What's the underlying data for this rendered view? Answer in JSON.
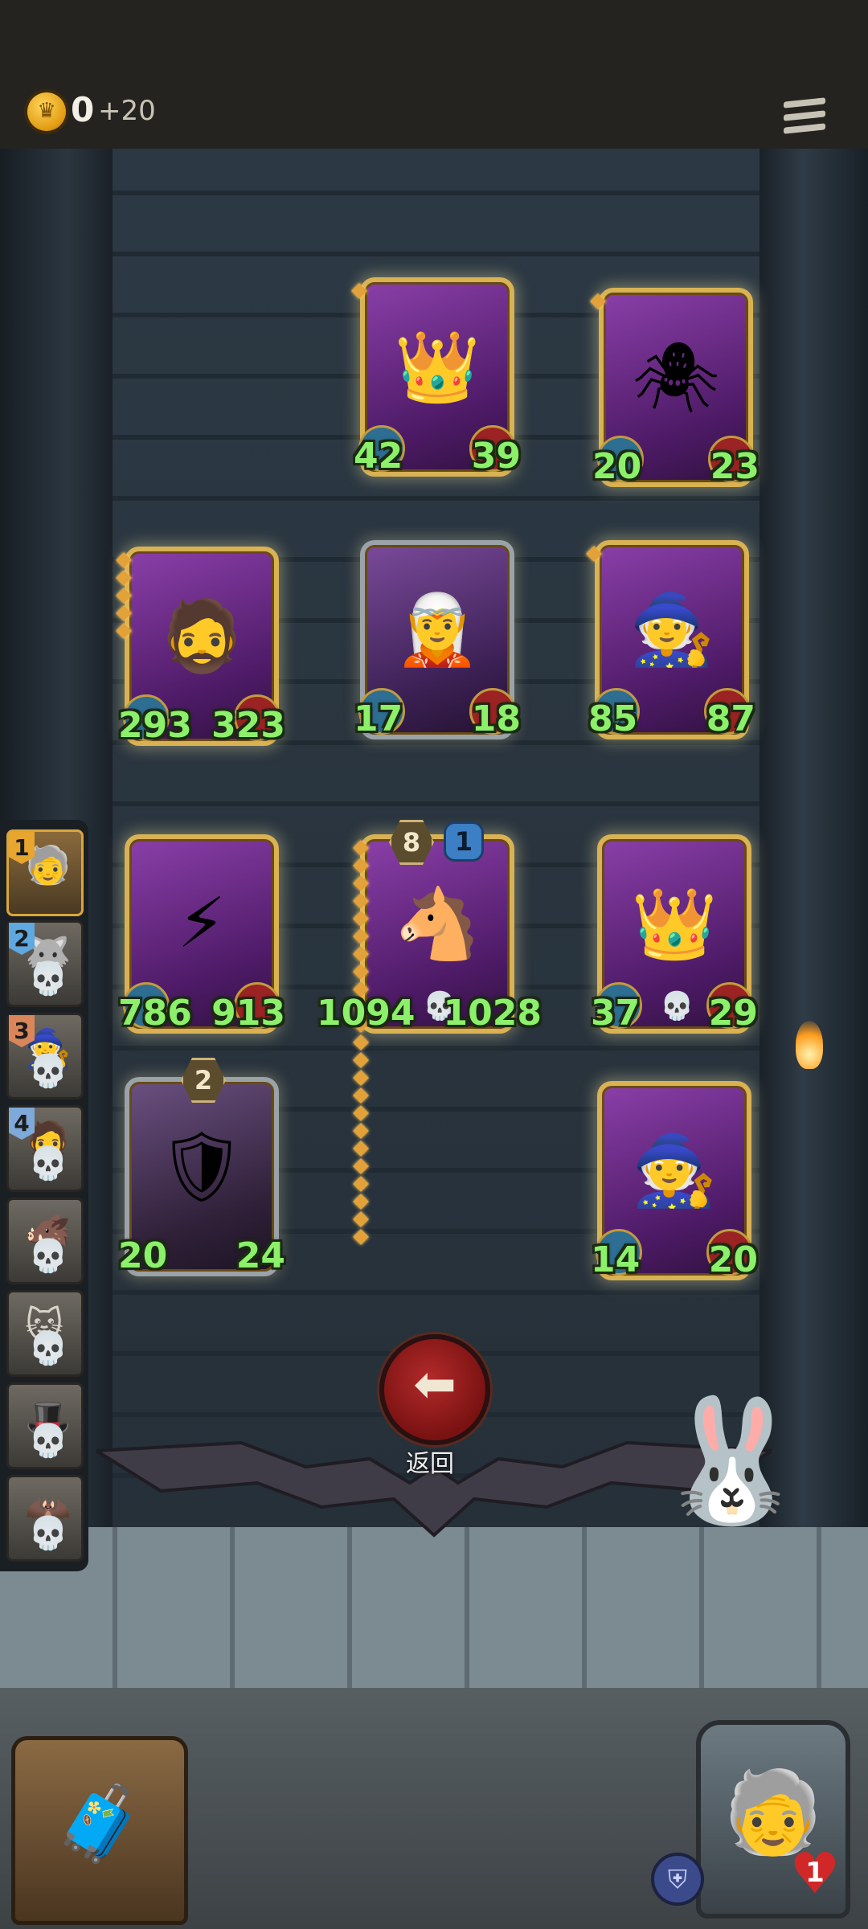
{
  "hud": {
    "gold": "0",
    "gold_bonus": "+20",
    "coin_icon": "crown-coin-icon",
    "menu_icon": "menu-icon"
  },
  "board": {
    "cards": [
      {
        "name": "king-card-top",
        "icon": "👑",
        "atk": "42",
        "hp": "39"
      },
      {
        "name": "spider-mushroom-card",
        "icon": "🕷",
        "atk": "20",
        "hp": "23"
      },
      {
        "name": "brute-card",
        "icon": "🧔",
        "atk": "293",
        "hp": "323"
      },
      {
        "name": "elf-sorceress-card",
        "icon": "🧝",
        "atk": "17",
        "hp": "18"
      },
      {
        "name": "blue-hair-mage-card-1",
        "icon": "🧙",
        "atk": "85",
        "hp": "87"
      },
      {
        "name": "blonde-hero-card",
        "icon": "⚡",
        "atk": "786",
        "hp": "913"
      },
      {
        "name": "spirit-horse-card",
        "icon": "🐴",
        "atk": "1094",
        "hp": "1028",
        "level": "8",
        "tier": "1"
      },
      {
        "name": "king-card-2",
        "icon": "👑",
        "atk": "37",
        "hp": "29"
      },
      {
        "name": "shield-knight-card",
        "icon": "🛡",
        "atk": "20",
        "hp": "24",
        "level": "2"
      },
      {
        "name": "blue-hair-mage-card-2",
        "icon": "🧙",
        "atk": "14",
        "hp": "20"
      }
    ]
  },
  "queue": {
    "items": [
      {
        "num": "1",
        "face": "🧓"
      },
      {
        "num": "2",
        "face": "🐺"
      },
      {
        "num": "3",
        "face": "🧙"
      },
      {
        "num": "4",
        "face": "🧔"
      },
      {
        "num": "",
        "face": "🐗"
      },
      {
        "num": "",
        "face": "🐱"
      },
      {
        "num": "",
        "face": "🎩"
      },
      {
        "num": "",
        "face": "🦇"
      }
    ],
    "colors": {
      "gold": "#e8a62f",
      "blue": "#5fa8e0",
      "bronze": "#d9875a",
      "steel": "#7fa9d8"
    }
  },
  "back": {
    "label": "返回"
  },
  "player": {
    "hp": "1"
  }
}
